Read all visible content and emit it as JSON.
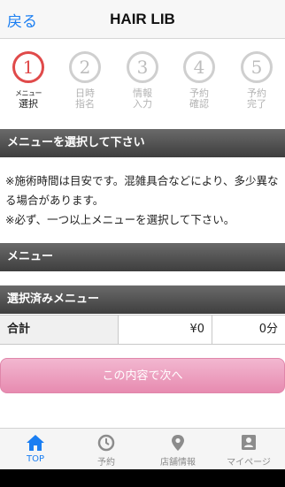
{
  "header": {
    "back_label": "戻る",
    "title": "HAIR LIB"
  },
  "steps": [
    {
      "num": "1",
      "line1": "メニュー",
      "line2": "選択",
      "active": true
    },
    {
      "num": "2",
      "line1": "日時",
      "line2": "指名",
      "active": false
    },
    {
      "num": "3",
      "line1": "情報",
      "line2": "入力",
      "active": false
    },
    {
      "num": "4",
      "line1": "予約",
      "line2": "確認",
      "active": false
    },
    {
      "num": "5",
      "line1": "予約",
      "line2": "完了",
      "active": false
    }
  ],
  "section_select": "メニューを選択して下さい",
  "notice": {
    "line1": "※施術時間は目安です。混雑具合などにより、多少異なる場合があります。",
    "line2": "※必ず、一つ以上メニューを選択して下さい。"
  },
  "section_menu": "メニュー",
  "section_selected": "選択済みメニュー",
  "summary": {
    "label": "合計",
    "price": "¥0",
    "time": "0分"
  },
  "next_button": "この内容で次へ",
  "tabs": [
    {
      "label": "TOP",
      "icon": "home-icon",
      "active": true
    },
    {
      "label": "予約",
      "icon": "clock-icon",
      "active": false
    },
    {
      "label": "店舗情報",
      "icon": "location-pin-icon",
      "active": false
    },
    {
      "label": "マイページ",
      "icon": "profile-card-icon",
      "active": false
    }
  ],
  "colors": {
    "accent": "#1a7ef2",
    "active_step": "#e04a4a",
    "button": "#e78bb0"
  }
}
